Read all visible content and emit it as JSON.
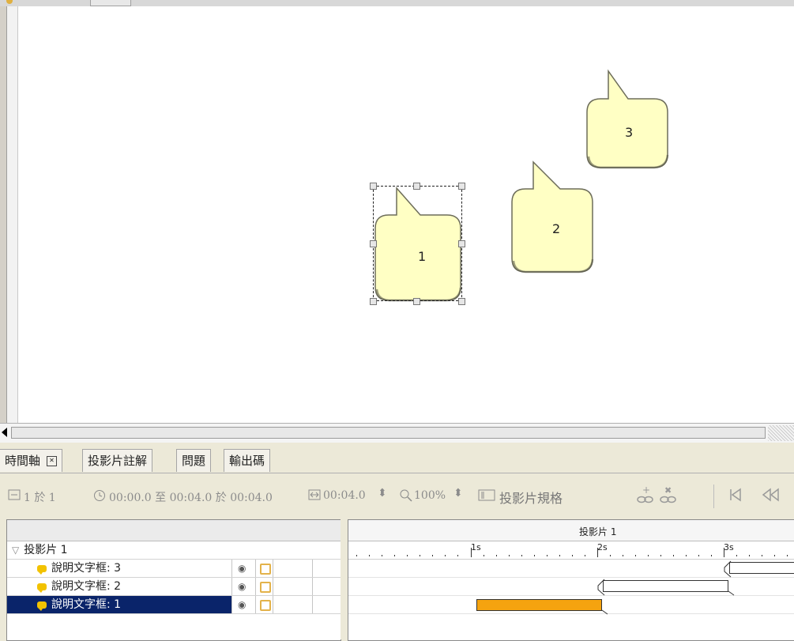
{
  "canvas": {
    "callouts": [
      {
        "label": "1",
        "selected": true
      },
      {
        "label": "2",
        "selected": false
      },
      {
        "label": "3",
        "selected": false
      }
    ],
    "callout_fill": "#ffffc4"
  },
  "panel": {
    "tabs": [
      {
        "label": "時間軸",
        "closable": true
      },
      {
        "label": "投影片註解"
      },
      {
        "label": "問題"
      },
      {
        "label": "輸出碼"
      }
    ]
  },
  "toolbar": {
    "slide_of": "1 於 1",
    "time_range": "00:00.0 至 00:04.0 於 00:04.0",
    "duration": "00:04.0",
    "zoom": "100%",
    "slide_props": "投影片規格"
  },
  "layers": {
    "group": "投影片 1",
    "items": [
      {
        "label": "說明文字框: 3",
        "selected": false
      },
      {
        "label": "說明文字框: 2",
        "selected": false
      },
      {
        "label": "說明文字框: 1",
        "selected": true
      }
    ]
  },
  "timeline": {
    "header": "投影片 1",
    "ruler_labels": [
      "1s",
      "2s",
      "3s"
    ],
    "bar_colors": {
      "selected": "#f5a30f",
      "normal": "#ffffff"
    }
  }
}
